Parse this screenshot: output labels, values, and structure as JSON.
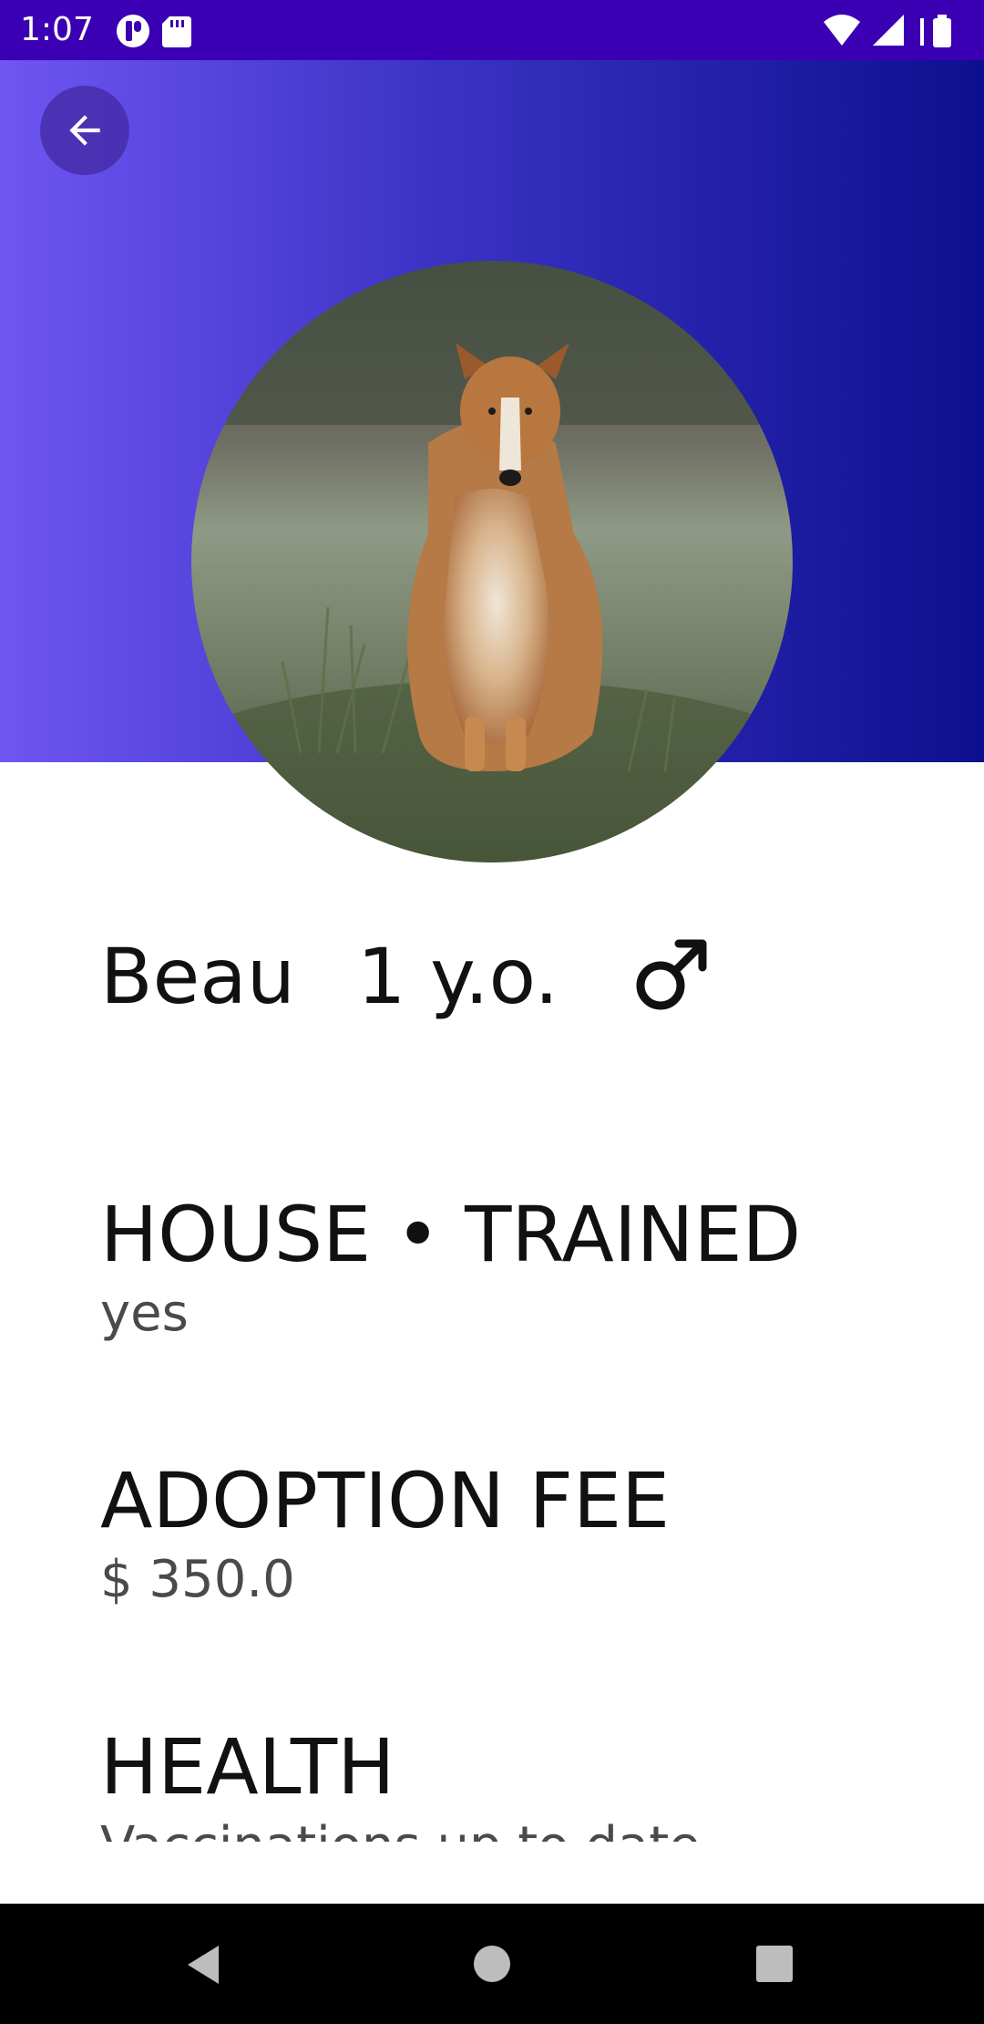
{
  "status_bar": {
    "time": "1:07",
    "left_icons": [
      "p-app-icon",
      "sd-card-icon"
    ],
    "right_icons": [
      "wifi-icon",
      "cell-signal-icon",
      "battery-icon"
    ],
    "bg_color": "#3b00b3"
  },
  "header": {
    "gradient_colors": [
      "#6f55f2",
      "#0c108e"
    ],
    "back_icon": "arrow-back-icon"
  },
  "pet": {
    "name": "Beau",
    "age": "1 y.o.",
    "gender_icon": "male-symbol-icon"
  },
  "details": [
    {
      "label": "HOUSE • TRAINED",
      "value": "yes"
    },
    {
      "label": "ADOPTION FEE",
      "value": "$ 350.0"
    },
    {
      "label": "HEALTH",
      "value": "Vaccinations up to date"
    }
  ],
  "nav_bar": {
    "buttons": [
      "back-triangle-icon",
      "home-circle-icon",
      "recents-square-icon"
    ]
  }
}
